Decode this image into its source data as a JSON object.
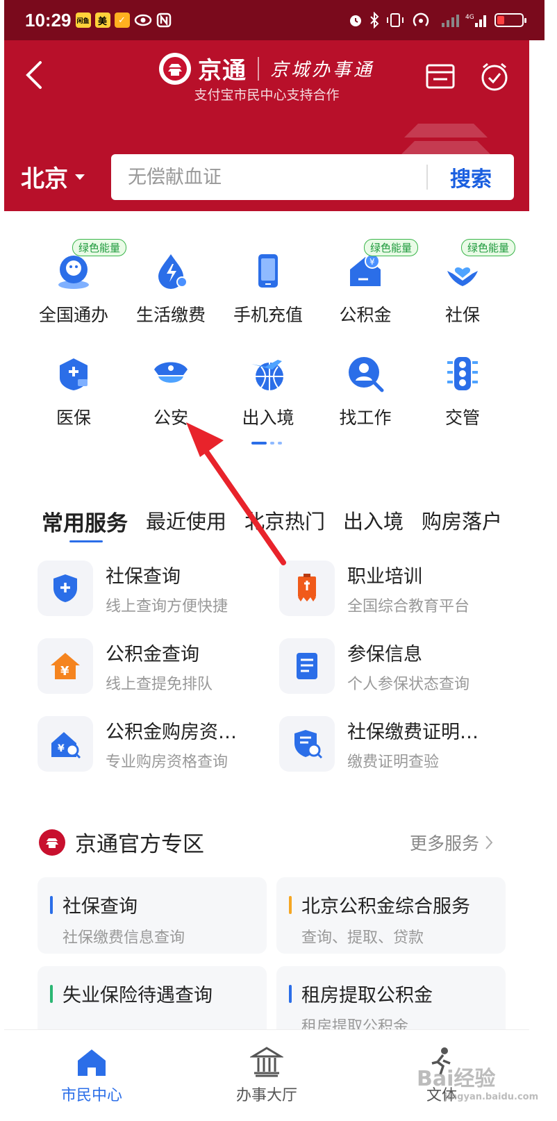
{
  "status_bar": {
    "time": "10:29",
    "badges": [
      "闲鱼",
      "美",
      "✓"
    ]
  },
  "header": {
    "brand_name": "京通",
    "brand_script": "京城办事通",
    "subtitle": "支付宝市民中心支持合作",
    "city": "北京",
    "search_placeholder": "无偿献血证",
    "search_button": "搜索",
    "bg_color": "#b8102a"
  },
  "grid": {
    "tag_label": "绿色能量",
    "items": [
      {
        "label": "全国通办",
        "icon": "globe-service-icon",
        "tag": true
      },
      {
        "label": "生活缴费",
        "icon": "lightning-drop-icon",
        "tag": false
      },
      {
        "label": "手机充值",
        "icon": "phone-icon",
        "tag": false
      },
      {
        "label": "公积金",
        "icon": "house-fund-icon",
        "tag": true
      },
      {
        "label": "社保",
        "icon": "heart-hands-icon",
        "tag": true
      },
      {
        "label": "医保",
        "icon": "medical-card-icon",
        "tag": false
      },
      {
        "label": "公安",
        "icon": "police-cap-icon",
        "tag": false
      },
      {
        "label": "出入境",
        "icon": "plane-globe-icon",
        "tag": false
      },
      {
        "label": "找工作",
        "icon": "person-search-icon",
        "tag": false
      },
      {
        "label": "交管",
        "icon": "traffic-light-icon",
        "tag": false
      }
    ]
  },
  "services": {
    "tabs": [
      "常用服务",
      "最近使用",
      "北京热门",
      "出入境",
      "购房落户"
    ],
    "items": [
      {
        "title": "社保查询",
        "sub": "线上查询方便快捷",
        "icon": "shield-plus-icon"
      },
      {
        "title": "职业培训",
        "sub": "全国综合教育平台",
        "icon": "training-banner-icon"
      },
      {
        "title": "公积金查询",
        "sub": "线上查提免排队",
        "icon": "house-yen-icon"
      },
      {
        "title": "参保信息",
        "sub": "个人参保状态查询",
        "icon": "document-icon"
      },
      {
        "title": "公积金购房资…",
        "sub": "专业购房资格查询",
        "icon": "house-search-icon"
      },
      {
        "title": "社保缴费证明…",
        "sub": "缴费证明查验",
        "icon": "doc-search-icon"
      }
    ]
  },
  "zone": {
    "title": "京通官方专区",
    "more": "更多服务",
    "items": [
      {
        "title": "社保查询",
        "sub": "社保缴费信息查询",
        "bar": "#2b6ee8"
      },
      {
        "title": "北京公积金综合服务",
        "sub": "查询、提取、贷款",
        "bar": "#f5a623"
      },
      {
        "title": "失业保险待遇查询",
        "sub": "",
        "bar": "#2bb673"
      },
      {
        "title": "租房提取公积金",
        "sub": "租房提取公积金",
        "bar": "#2b6ee8"
      }
    ]
  },
  "tabbar": [
    {
      "label": "市民中心",
      "active": true,
      "icon": "home-icon"
    },
    {
      "label": "办事大厅",
      "active": false,
      "icon": "hall-icon"
    },
    {
      "label": "文体",
      "active": false,
      "icon": "sports-icon"
    }
  ],
  "watermark": {
    "text": "Bai经验",
    "sub": "jingyan.baidu.com"
  }
}
